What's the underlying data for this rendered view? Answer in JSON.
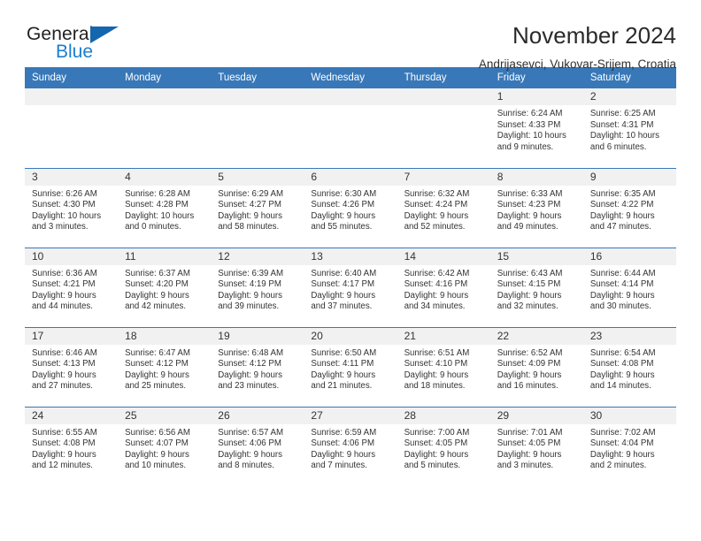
{
  "logo": {
    "word_top": "General",
    "word_bottom": "Blue",
    "accent_color": "#1466ae",
    "blue_text_color": "#1b7dd1"
  },
  "header": {
    "title": "November 2024",
    "subtitle": "Andrijasevci, Vukovar-Srijem, Croatia"
  },
  "theme": {
    "header_bg": "#3878b8",
    "daynum_bg": "#f1f1f1",
    "text": "#333333"
  },
  "weekday_headers": [
    "Sunday",
    "Monday",
    "Tuesday",
    "Wednesday",
    "Thursday",
    "Friday",
    "Saturday"
  ],
  "weeks": [
    [
      {
        "day": "",
        "empty": true
      },
      {
        "day": "",
        "empty": true
      },
      {
        "day": "",
        "empty": true
      },
      {
        "day": "",
        "empty": true
      },
      {
        "day": "",
        "empty": true
      },
      {
        "day": "1",
        "sunrise": "Sunrise: 6:24 AM",
        "sunset": "Sunset: 4:33 PM",
        "daylight_1": "Daylight: 10 hours",
        "daylight_2": "and 9 minutes."
      },
      {
        "day": "2",
        "sunrise": "Sunrise: 6:25 AM",
        "sunset": "Sunset: 4:31 PM",
        "daylight_1": "Daylight: 10 hours",
        "daylight_2": "and 6 minutes."
      }
    ],
    [
      {
        "day": "3",
        "sunrise": "Sunrise: 6:26 AM",
        "sunset": "Sunset: 4:30 PM",
        "daylight_1": "Daylight: 10 hours",
        "daylight_2": "and 3 minutes."
      },
      {
        "day": "4",
        "sunrise": "Sunrise: 6:28 AM",
        "sunset": "Sunset: 4:28 PM",
        "daylight_1": "Daylight: 10 hours",
        "daylight_2": "and 0 minutes."
      },
      {
        "day": "5",
        "sunrise": "Sunrise: 6:29 AM",
        "sunset": "Sunset: 4:27 PM",
        "daylight_1": "Daylight: 9 hours",
        "daylight_2": "and 58 minutes."
      },
      {
        "day": "6",
        "sunrise": "Sunrise: 6:30 AM",
        "sunset": "Sunset: 4:26 PM",
        "daylight_1": "Daylight: 9 hours",
        "daylight_2": "and 55 minutes."
      },
      {
        "day": "7",
        "sunrise": "Sunrise: 6:32 AM",
        "sunset": "Sunset: 4:24 PM",
        "daylight_1": "Daylight: 9 hours",
        "daylight_2": "and 52 minutes."
      },
      {
        "day": "8",
        "sunrise": "Sunrise: 6:33 AM",
        "sunset": "Sunset: 4:23 PM",
        "daylight_1": "Daylight: 9 hours",
        "daylight_2": "and 49 minutes."
      },
      {
        "day": "9",
        "sunrise": "Sunrise: 6:35 AM",
        "sunset": "Sunset: 4:22 PM",
        "daylight_1": "Daylight: 9 hours",
        "daylight_2": "and 47 minutes."
      }
    ],
    [
      {
        "day": "10",
        "sunrise": "Sunrise: 6:36 AM",
        "sunset": "Sunset: 4:21 PM",
        "daylight_1": "Daylight: 9 hours",
        "daylight_2": "and 44 minutes."
      },
      {
        "day": "11",
        "sunrise": "Sunrise: 6:37 AM",
        "sunset": "Sunset: 4:20 PM",
        "daylight_1": "Daylight: 9 hours",
        "daylight_2": "and 42 minutes."
      },
      {
        "day": "12",
        "sunrise": "Sunrise: 6:39 AM",
        "sunset": "Sunset: 4:19 PM",
        "daylight_1": "Daylight: 9 hours",
        "daylight_2": "and 39 minutes."
      },
      {
        "day": "13",
        "sunrise": "Sunrise: 6:40 AM",
        "sunset": "Sunset: 4:17 PM",
        "daylight_1": "Daylight: 9 hours",
        "daylight_2": "and 37 minutes."
      },
      {
        "day": "14",
        "sunrise": "Sunrise: 6:42 AM",
        "sunset": "Sunset: 4:16 PM",
        "daylight_1": "Daylight: 9 hours",
        "daylight_2": "and 34 minutes."
      },
      {
        "day": "15",
        "sunrise": "Sunrise: 6:43 AM",
        "sunset": "Sunset: 4:15 PM",
        "daylight_1": "Daylight: 9 hours",
        "daylight_2": "and 32 minutes."
      },
      {
        "day": "16",
        "sunrise": "Sunrise: 6:44 AM",
        "sunset": "Sunset: 4:14 PM",
        "daylight_1": "Daylight: 9 hours",
        "daylight_2": "and 30 minutes."
      }
    ],
    [
      {
        "day": "17",
        "sunrise": "Sunrise: 6:46 AM",
        "sunset": "Sunset: 4:13 PM",
        "daylight_1": "Daylight: 9 hours",
        "daylight_2": "and 27 minutes."
      },
      {
        "day": "18",
        "sunrise": "Sunrise: 6:47 AM",
        "sunset": "Sunset: 4:12 PM",
        "daylight_1": "Daylight: 9 hours",
        "daylight_2": "and 25 minutes."
      },
      {
        "day": "19",
        "sunrise": "Sunrise: 6:48 AM",
        "sunset": "Sunset: 4:12 PM",
        "daylight_1": "Daylight: 9 hours",
        "daylight_2": "and 23 minutes."
      },
      {
        "day": "20",
        "sunrise": "Sunrise: 6:50 AM",
        "sunset": "Sunset: 4:11 PM",
        "daylight_1": "Daylight: 9 hours",
        "daylight_2": "and 21 minutes."
      },
      {
        "day": "21",
        "sunrise": "Sunrise: 6:51 AM",
        "sunset": "Sunset: 4:10 PM",
        "daylight_1": "Daylight: 9 hours",
        "daylight_2": "and 18 minutes."
      },
      {
        "day": "22",
        "sunrise": "Sunrise: 6:52 AM",
        "sunset": "Sunset: 4:09 PM",
        "daylight_1": "Daylight: 9 hours",
        "daylight_2": "and 16 minutes."
      },
      {
        "day": "23",
        "sunrise": "Sunrise: 6:54 AM",
        "sunset": "Sunset: 4:08 PM",
        "daylight_1": "Daylight: 9 hours",
        "daylight_2": "and 14 minutes."
      }
    ],
    [
      {
        "day": "24",
        "sunrise": "Sunrise: 6:55 AM",
        "sunset": "Sunset: 4:08 PM",
        "daylight_1": "Daylight: 9 hours",
        "daylight_2": "and 12 minutes."
      },
      {
        "day": "25",
        "sunrise": "Sunrise: 6:56 AM",
        "sunset": "Sunset: 4:07 PM",
        "daylight_1": "Daylight: 9 hours",
        "daylight_2": "and 10 minutes."
      },
      {
        "day": "26",
        "sunrise": "Sunrise: 6:57 AM",
        "sunset": "Sunset: 4:06 PM",
        "daylight_1": "Daylight: 9 hours",
        "daylight_2": "and 8 minutes."
      },
      {
        "day": "27",
        "sunrise": "Sunrise: 6:59 AM",
        "sunset": "Sunset: 4:06 PM",
        "daylight_1": "Daylight: 9 hours",
        "daylight_2": "and 7 minutes."
      },
      {
        "day": "28",
        "sunrise": "Sunrise: 7:00 AM",
        "sunset": "Sunset: 4:05 PM",
        "daylight_1": "Daylight: 9 hours",
        "daylight_2": "and 5 minutes."
      },
      {
        "day": "29",
        "sunrise": "Sunrise: 7:01 AM",
        "sunset": "Sunset: 4:05 PM",
        "daylight_1": "Daylight: 9 hours",
        "daylight_2": "and 3 minutes."
      },
      {
        "day": "30",
        "sunrise": "Sunrise: 7:02 AM",
        "sunset": "Sunset: 4:04 PM",
        "daylight_1": "Daylight: 9 hours",
        "daylight_2": "and 2 minutes."
      }
    ]
  ]
}
